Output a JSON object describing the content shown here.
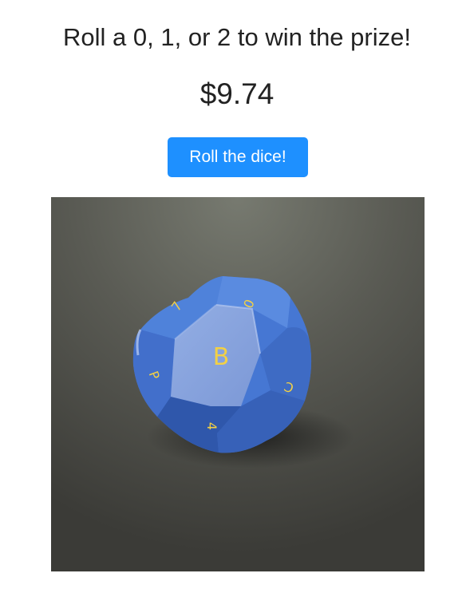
{
  "header": {
    "title": "Roll a 0, 1, or 2 to win the prize!",
    "prize": "$9.74"
  },
  "actions": {
    "roll_label": "Roll the dice!"
  },
  "dice": {
    "shape": "twelve-sided die (dodecahedron)",
    "body_color": "#3f72cf",
    "glyph_color": "#f2d045",
    "top_face_glyph": "B",
    "side_face_glyphs": [
      "7",
      "0",
      "C",
      "P",
      "4"
    ]
  },
  "colors": {
    "accent": "#1e90ff",
    "scene_background": "#4f4f4a"
  }
}
